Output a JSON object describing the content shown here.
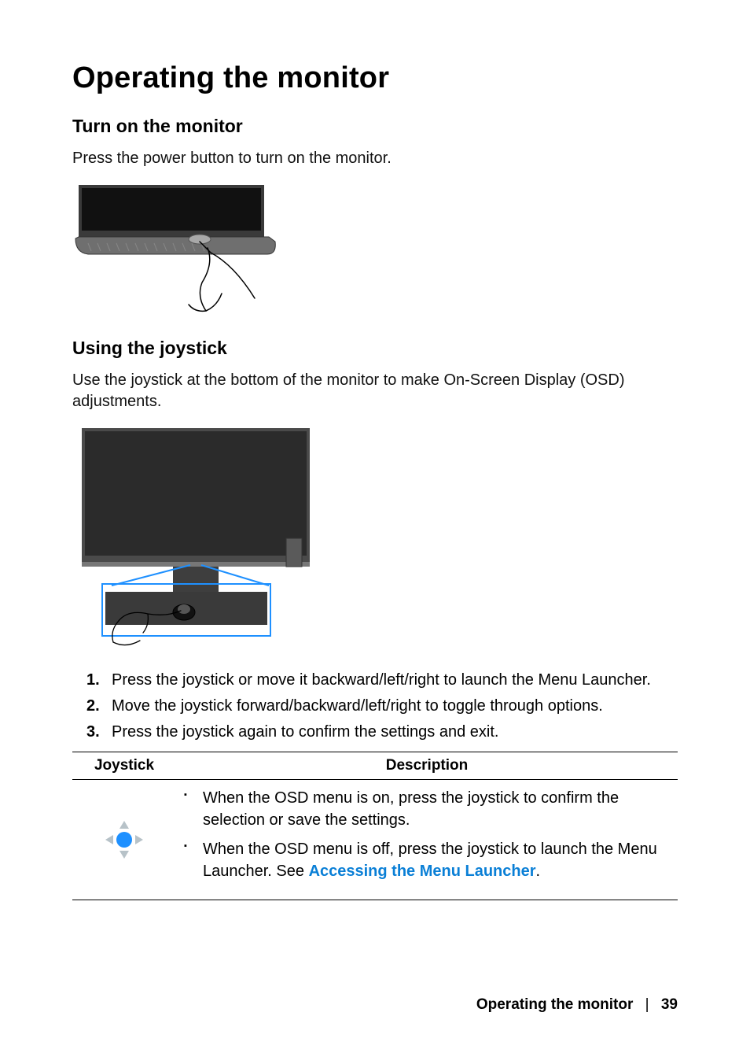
{
  "heading": "Operating the monitor",
  "section1": {
    "title": "Turn on the monitor",
    "body": "Press the power button to turn on the monitor."
  },
  "section2": {
    "title": "Using the joystick",
    "body": "Use the joystick at the bottom of the monitor to make On-Screen Display (OSD) adjustments.",
    "steps": [
      "Press the joystick or move it backward/left/right to launch the Menu Launcher.",
      "Move the joystick forward/backward/left/right to toggle through options.",
      "Press the joystick again to confirm the settings and exit."
    ]
  },
  "table": {
    "headers": {
      "col1": "Joystick",
      "col2": "Description"
    },
    "row1": {
      "bullet1": "When the OSD menu is on, press the joystick to confirm the selection or save the settings.",
      "bullet2_pre": "When the OSD menu is off, press the joystick to launch the Menu Launcher. See ",
      "bullet2_link": "Accessing the Menu Launcher",
      "bullet2_post": "."
    }
  },
  "footer": {
    "title": "Operating the monitor",
    "sep": "|",
    "page": "39"
  }
}
